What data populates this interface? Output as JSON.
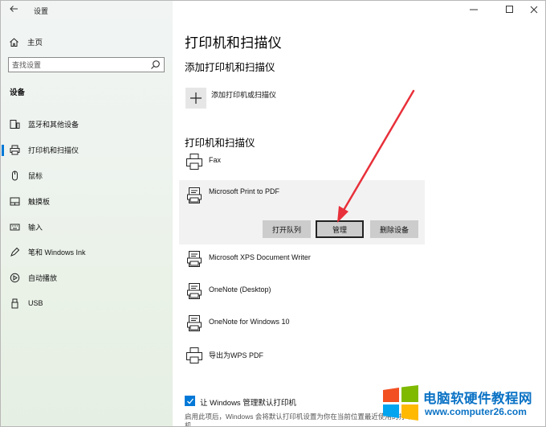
{
  "window": {
    "title": "设置",
    "minimize": "—",
    "maximize": "☐",
    "close": "✕"
  },
  "sidebar": {
    "home": "主页",
    "search_placeholder": "查找设置",
    "section": "设备",
    "items": [
      {
        "label": "蓝牙和其他设备",
        "icon": "devices-icon"
      },
      {
        "label": "打印机和扫描仪",
        "icon": "printer-icon",
        "active": true
      },
      {
        "label": "鼠标",
        "icon": "mouse-icon"
      },
      {
        "label": "触摸板",
        "icon": "touchpad-icon"
      },
      {
        "label": "输入",
        "icon": "keyboard-icon"
      },
      {
        "label": "笔和 Windows Ink",
        "icon": "pen-icon"
      },
      {
        "label": "自动播放",
        "icon": "autoplay-icon"
      },
      {
        "label": "USB",
        "icon": "usb-icon"
      }
    ]
  },
  "main": {
    "title": "打印机和扫描仪",
    "add_section": "添加打印机和扫描仪",
    "add_label": "添加打印机或扫描仪",
    "list_section": "打印机和扫描仪",
    "printers": [
      {
        "name": "Fax",
        "icon": "fax-icon"
      },
      {
        "name": "Microsoft Print to PDF",
        "icon": "pdf-printer-icon",
        "selected": true
      },
      {
        "name": "Microsoft XPS Document Writer",
        "icon": "xps-printer-icon"
      },
      {
        "name": "OneNote (Desktop)",
        "icon": "onenote-printer-icon"
      },
      {
        "name": "OneNote for Windows 10",
        "icon": "onenote-printer-icon"
      },
      {
        "name": "导出为WPS PDF",
        "icon": "wps-printer-icon"
      }
    ],
    "buttons": {
      "open_queue": "打开队列",
      "manage": "管理",
      "remove": "删除设备"
    },
    "default_checkbox": "让 Windows 管理默认打印机",
    "default_desc": "启用此项后，Windows 会将默认打印机设置为你在当前位置最近使用的打印机。"
  },
  "watermark": {
    "title": "电脑软硬件教程网",
    "url": "www.computer26.com"
  },
  "colors": {
    "accent": "#0078d7",
    "arrow": "#e8303a",
    "watermark": "#0a72c5"
  }
}
